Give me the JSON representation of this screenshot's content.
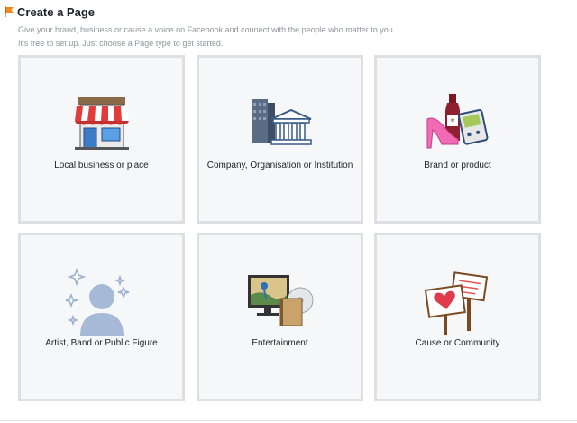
{
  "header": {
    "title": "Create a Page",
    "icon": "flag-icon"
  },
  "intro": {
    "line1": "Give your brand, business or cause a voice on Facebook and connect with the people who matter to you.",
    "line2": "It's free to set up. Just choose a Page type to get started."
  },
  "categories": [
    {
      "label": "Local business or place",
      "icon": "storefront-icon"
    },
    {
      "label": "Company, Organisation or Institution",
      "icon": "building-icon"
    },
    {
      "label": "Brand or product",
      "icon": "products-icon"
    },
    {
      "label": "Artist, Band or Public Figure",
      "icon": "public-figure-icon"
    },
    {
      "label": "Entertainment",
      "icon": "entertainment-icon"
    },
    {
      "label": "Cause or Community",
      "icon": "signs-icon"
    }
  ],
  "colors": {
    "tile_bg": "#f6f7f9",
    "tile_border": "#dddfe2",
    "accent": "#4267b2"
  }
}
